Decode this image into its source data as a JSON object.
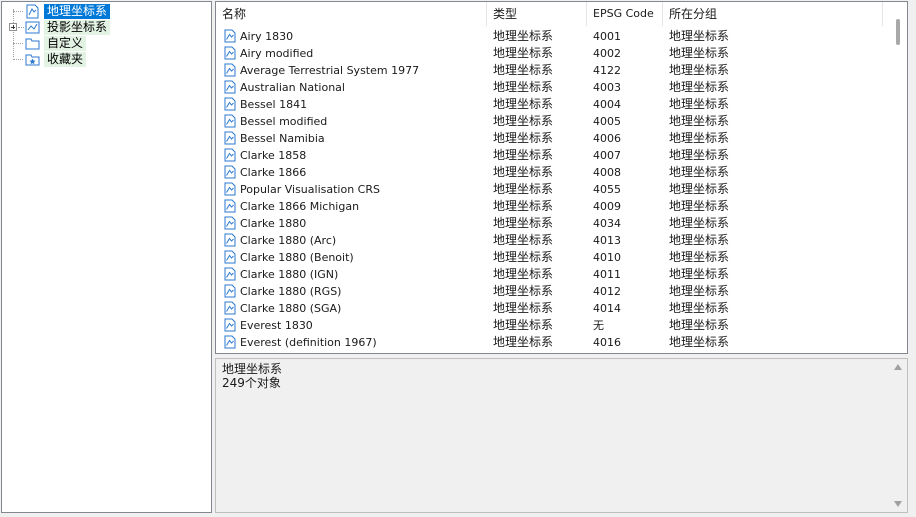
{
  "tree": {
    "items": [
      {
        "label": "地理坐标系",
        "icon": "geographic-crs-icon",
        "selected": true,
        "expandable": false
      },
      {
        "label": "投影坐标系",
        "icon": "projected-crs-icon",
        "selected": false,
        "expandable": true
      },
      {
        "label": "自定义",
        "icon": "folder-icon",
        "selected": false,
        "expandable": false
      },
      {
        "label": "收藏夹",
        "icon": "favorites-icon",
        "selected": false,
        "expandable": false
      }
    ]
  },
  "list": {
    "columns": [
      "名称",
      "类型",
      "EPSG Code",
      "所在分组"
    ],
    "rows": [
      {
        "name": "Airy 1830",
        "type": "地理坐标系",
        "code": "4001",
        "group": "地理坐标系"
      },
      {
        "name": "Airy modified",
        "type": "地理坐标系",
        "code": "4002",
        "group": "地理坐标系"
      },
      {
        "name": "Average Terrestrial System 1977",
        "type": "地理坐标系",
        "code": "4122",
        "group": "地理坐标系"
      },
      {
        "name": "Australian National",
        "type": "地理坐标系",
        "code": "4003",
        "group": "地理坐标系"
      },
      {
        "name": "Bessel 1841",
        "type": "地理坐标系",
        "code": "4004",
        "group": "地理坐标系"
      },
      {
        "name": "Bessel modified",
        "type": "地理坐标系",
        "code": "4005",
        "group": "地理坐标系"
      },
      {
        "name": "Bessel Namibia",
        "type": "地理坐标系",
        "code": "4006",
        "group": "地理坐标系"
      },
      {
        "name": "Clarke 1858",
        "type": "地理坐标系",
        "code": "4007",
        "group": "地理坐标系"
      },
      {
        "name": "Clarke 1866",
        "type": "地理坐标系",
        "code": "4008",
        "group": "地理坐标系"
      },
      {
        "name": "Popular Visualisation CRS",
        "type": "地理坐标系",
        "code": "4055",
        "group": "地理坐标系"
      },
      {
        "name": "Clarke 1866 Michigan",
        "type": "地理坐标系",
        "code": "4009",
        "group": "地理坐标系"
      },
      {
        "name": "Clarke 1880",
        "type": "地理坐标系",
        "code": "4034",
        "group": "地理坐标系"
      },
      {
        "name": "Clarke 1880 (Arc)",
        "type": "地理坐标系",
        "code": "4013",
        "group": "地理坐标系"
      },
      {
        "name": "Clarke 1880 (Benoit)",
        "type": "地理坐标系",
        "code": "4010",
        "group": "地理坐标系"
      },
      {
        "name": "Clarke 1880 (IGN)",
        "type": "地理坐标系",
        "code": "4011",
        "group": "地理坐标系"
      },
      {
        "name": "Clarke 1880 (RGS)",
        "type": "地理坐标系",
        "code": "4012",
        "group": "地理坐标系"
      },
      {
        "name": "Clarke 1880 (SGA)",
        "type": "地理坐标系",
        "code": "4014",
        "group": "地理坐标系"
      },
      {
        "name": "Everest 1830",
        "type": "地理坐标系",
        "code": "无",
        "group": "地理坐标系"
      },
      {
        "name": "Everest (definition 1967)",
        "type": "地理坐标系",
        "code": "4016",
        "group": "地理坐标系"
      }
    ]
  },
  "description": {
    "line1": "地理坐标系",
    "line2": "249个对象"
  },
  "colors": {
    "selection": "#0078d7",
    "icon_blue": "#2b79d0",
    "tree_label_bg": "#e3f3e3"
  }
}
